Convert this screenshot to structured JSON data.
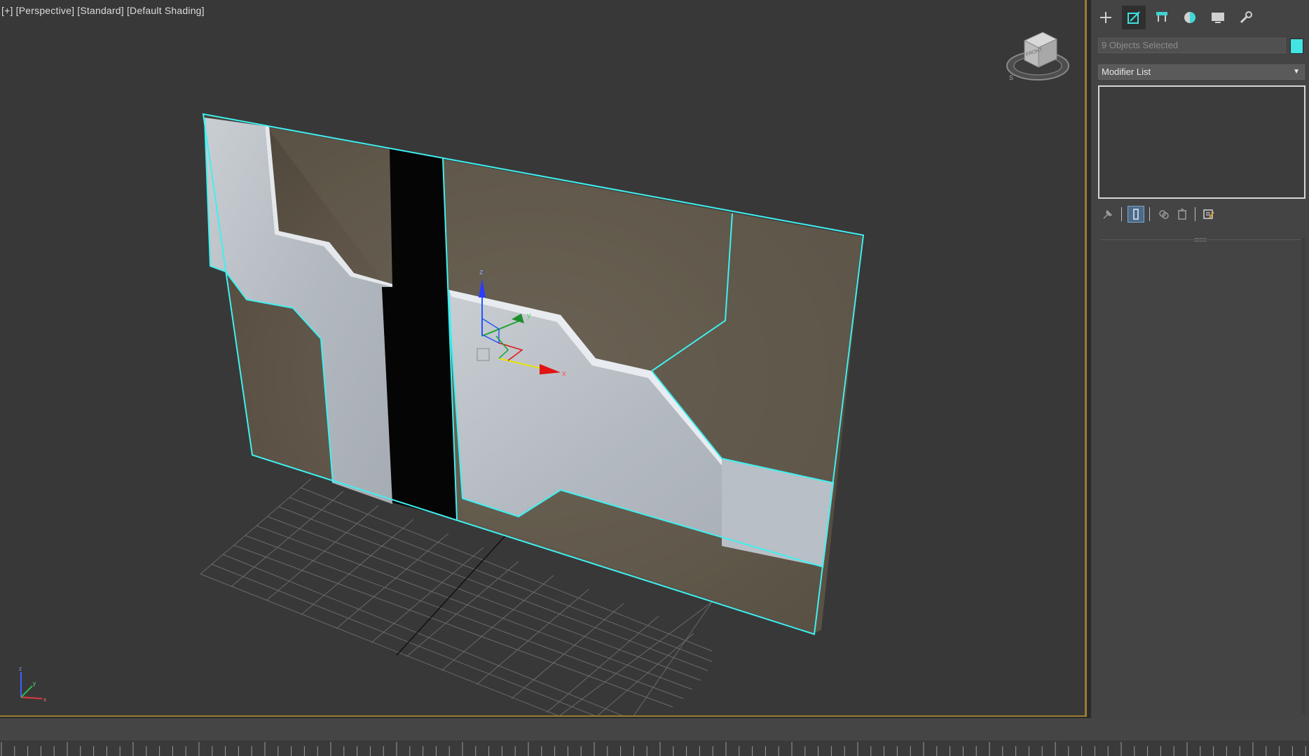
{
  "viewport": {
    "label": "[+] [Perspective] [Standard] [Default Shading]",
    "viewcube_face": "FRONT",
    "gizmo_labels": {
      "x": "x",
      "y": "y",
      "z": "z"
    }
  },
  "command_panel": {
    "tabs": [
      {
        "name": "create-tab",
        "icon": "plus-icon",
        "active": false
      },
      {
        "name": "modify-tab",
        "icon": "modify-icon",
        "active": true
      },
      {
        "name": "hierarchy-tab",
        "icon": "hierarchy-icon",
        "active": false
      },
      {
        "name": "motion-tab",
        "icon": "motion-icon",
        "active": false
      },
      {
        "name": "display-tab",
        "icon": "display-icon",
        "active": false
      },
      {
        "name": "utilities-tab",
        "icon": "wrench-icon",
        "active": false
      }
    ],
    "selection_name": "9 Objects Selected",
    "selection_color": "#42e3e3",
    "modifier_list": "Modifier List",
    "stack_buttons": [
      "pin-stack-icon",
      "show-end-result-icon",
      "make-unique-icon",
      "remove-modifier-icon",
      "configure-modifier-sets-icon"
    ]
  },
  "colors": {
    "viewport_bg": "#383838",
    "panel_bg": "#444444",
    "selection_outline": "#3ff0f0",
    "active_border": "#9b7d2f"
  }
}
